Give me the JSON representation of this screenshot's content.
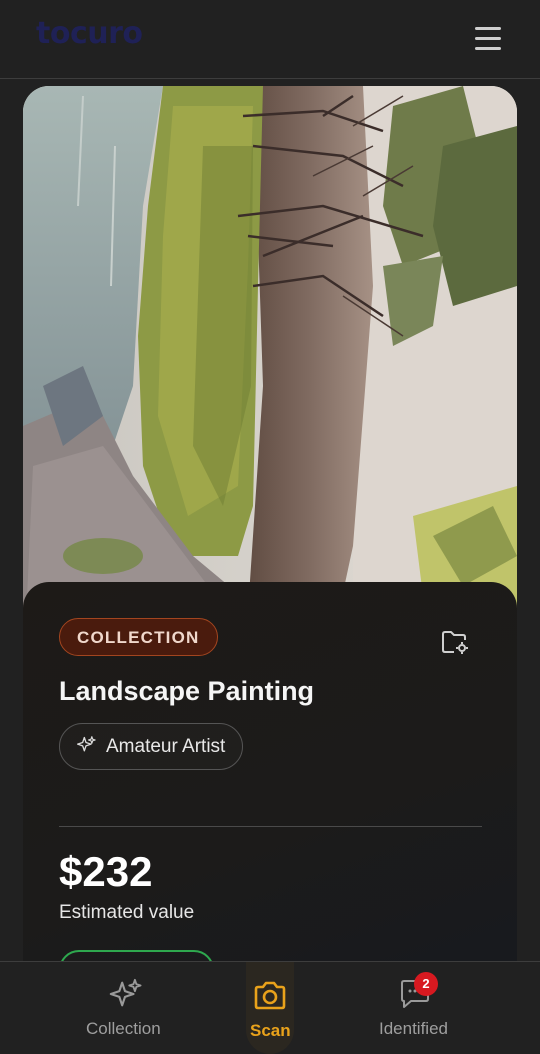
{
  "header": {
    "logo": "tocuro",
    "menu_icon": "hamburger-menu-icon"
  },
  "artwork": {
    "image_alt": "Landscape painting photographed sideways: trees, a path and a river",
    "category_badge": "COLLECTION",
    "folder_icon": "folder-settings-icon",
    "title": "Landscape Painting",
    "artist_icon": "sparkles-icon",
    "artist": "Amateur Artist",
    "price": "$232",
    "price_caption": "Estimated value"
  },
  "nav": {
    "items": [
      {
        "label": "Collection",
        "icon": "sparkles-icon",
        "active": false
      },
      {
        "label": "Scan",
        "icon": "camera-icon",
        "active": true
      },
      {
        "label": "Identified",
        "icon": "message-icon",
        "active": false,
        "badge": "2"
      }
    ]
  },
  "colors": {
    "background": "#212121",
    "active_accent": "#e9a21b",
    "badge_bg": "#4a1b0d",
    "badge_border": "#a3451f",
    "notification": "#d71920",
    "success_outline": "#2ea84e"
  }
}
